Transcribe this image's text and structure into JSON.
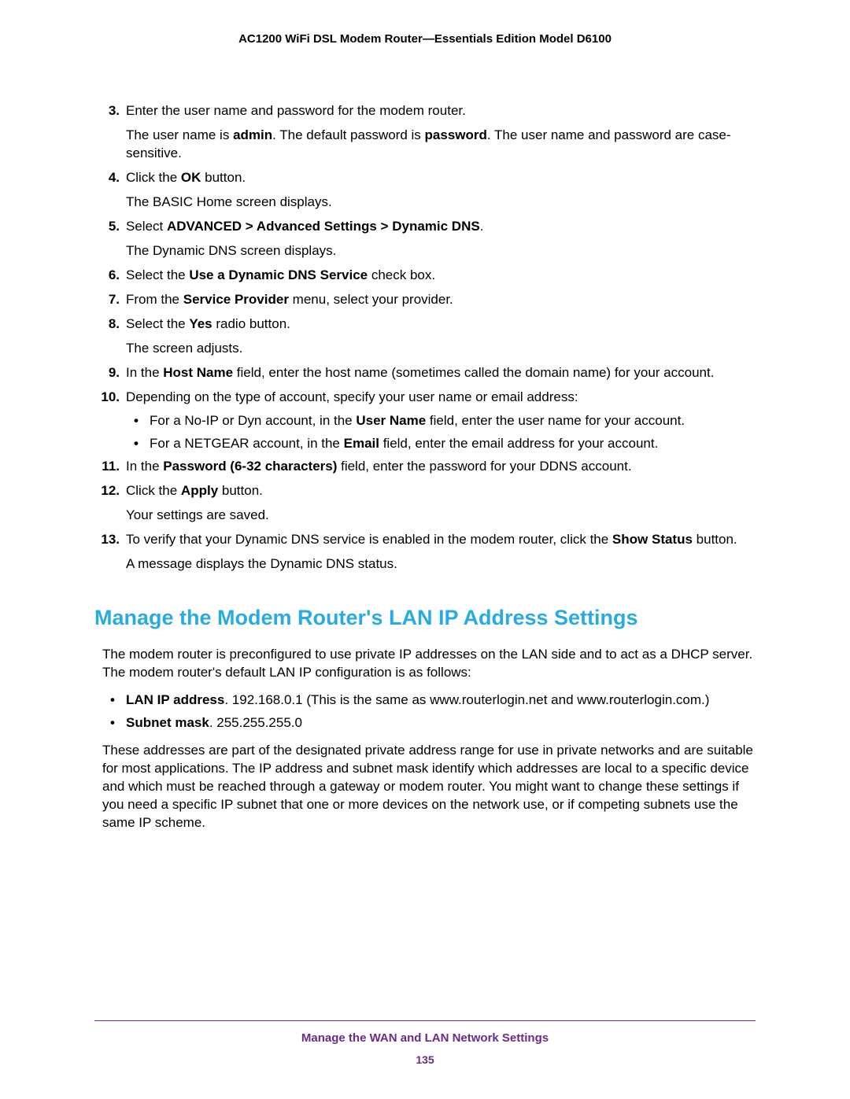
{
  "header": {
    "title": "AC1200 WiFi DSL Modem Router—Essentials Edition Model D6100"
  },
  "steps": [
    {
      "num": "3.",
      "lines": [
        [
          {
            "t": "Enter the user name and password for the modem router."
          }
        ],
        [
          {
            "t": "The user name is "
          },
          {
            "t": "admin",
            "b": true
          },
          {
            "t": ". The default password is "
          },
          {
            "t": "password",
            "b": true
          },
          {
            "t": ". The user name and password are case-sensitive."
          }
        ]
      ]
    },
    {
      "num": "4.",
      "lines": [
        [
          {
            "t": "Click the "
          },
          {
            "t": "OK",
            "b": true
          },
          {
            "t": " button."
          }
        ],
        [
          {
            "t": "The BASIC Home screen displays."
          }
        ]
      ]
    },
    {
      "num": "5.",
      "lines": [
        [
          {
            "t": "Select "
          },
          {
            "t": "ADVANCED > Advanced Settings > Dynamic DNS",
            "b": true
          },
          {
            "t": "."
          }
        ],
        [
          {
            "t": "The Dynamic DNS screen displays."
          }
        ]
      ]
    },
    {
      "num": "6.",
      "lines": [
        [
          {
            "t": "Select the "
          },
          {
            "t": "Use a Dynamic DNS Service",
            "b": true
          },
          {
            "t": " check box."
          }
        ]
      ]
    },
    {
      "num": "7.",
      "lines": [
        [
          {
            "t": "From the "
          },
          {
            "t": "Service Provider",
            "b": true
          },
          {
            "t": " menu, select your provider."
          }
        ]
      ]
    },
    {
      "num": "8.",
      "lines": [
        [
          {
            "t": "Select the "
          },
          {
            "t": "Yes",
            "b": true
          },
          {
            "t": " radio button."
          }
        ],
        [
          {
            "t": "The screen adjusts."
          }
        ]
      ]
    },
    {
      "num": "9.",
      "lines": [
        [
          {
            "t": "In the "
          },
          {
            "t": "Host Name",
            "b": true
          },
          {
            "t": " field, enter the host name (sometimes called the domain name) for your account."
          }
        ]
      ]
    },
    {
      "num": "10.",
      "lines": [
        [
          {
            "t": "Depending on the type of account, specify your user name or email address:"
          }
        ]
      ],
      "bullets": [
        [
          {
            "t": "For a No-IP or Dyn account, in the "
          },
          {
            "t": "User Name",
            "b": true
          },
          {
            "t": " field, enter the user name for your account."
          }
        ],
        [
          {
            "t": "For a NETGEAR account, in the "
          },
          {
            "t": "Email",
            "b": true
          },
          {
            "t": " field, enter the email address for your account."
          }
        ]
      ]
    },
    {
      "num": "11.",
      "lines": [
        [
          {
            "t": "In the "
          },
          {
            "t": "Password (6-32 characters)",
            "b": true
          },
          {
            "t": " field, enter the password for your DDNS account."
          }
        ]
      ]
    },
    {
      "num": "12.",
      "lines": [
        [
          {
            "t": "Click the "
          },
          {
            "t": "Apply",
            "b": true
          },
          {
            "t": " button."
          }
        ],
        [
          {
            "t": "Your settings are saved."
          }
        ]
      ]
    },
    {
      "num": "13.",
      "lines": [
        [
          {
            "t": "To verify that your Dynamic DNS service is enabled in the modem router, click the "
          },
          {
            "t": "Show Status",
            "b": true
          },
          {
            "t": " button."
          }
        ],
        [
          {
            "t": "A message displays the Dynamic DNS status."
          }
        ]
      ]
    }
  ],
  "section": {
    "heading": "Manage the Modem Router's LAN IP Address Settings",
    "para1": "The modem router is preconfigured to use private IP addresses on the LAN side and to act as a DHCP server. The modem router's default LAN IP configuration is as follows:",
    "bullets": [
      [
        {
          "t": "LAN IP address",
          "b": true
        },
        {
          "t": ". 192.168.0.1 (This is the same as www.routerlogin.net and www.routerlogin.com.)"
        }
      ],
      [
        {
          "t": "Subnet mask",
          "b": true
        },
        {
          "t": ". 255.255.255.0"
        }
      ]
    ],
    "para2": "These addresses are part of the designated private address range for use in private networks and are suitable for most applications. The IP address and subnet mask identify which addresses are local to a specific device and which must be reached through a gateway or modem router. You might want to change these settings if you need a specific IP subnet that one or more devices on the network use, or if competing subnets use the same IP scheme."
  },
  "footer": {
    "title": "Manage the WAN and LAN Network Settings",
    "page": "135"
  }
}
